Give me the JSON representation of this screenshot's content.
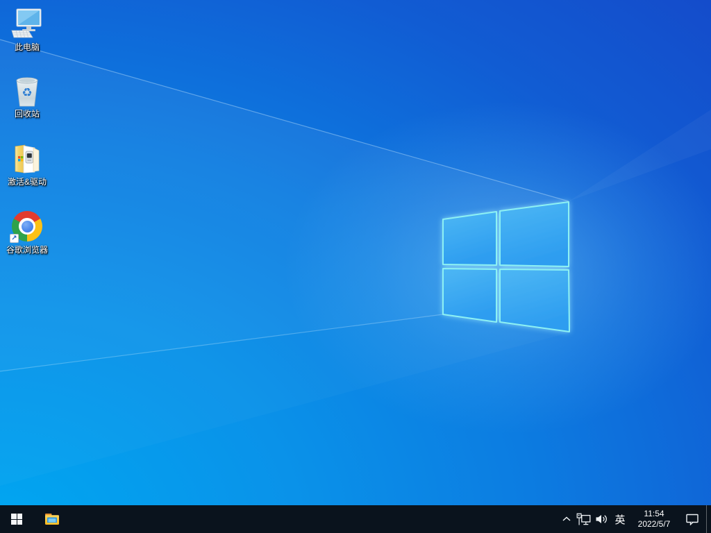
{
  "wallpaper": {
    "name": "windows-10-light-rays-default",
    "colors": {
      "base_bottom_left": "#00a7f1",
      "base_top_right": "#1547c8",
      "logo_pane_fill": "#38a9f1",
      "logo_pane_edge": "#8df1f3",
      "taskbar_background": "#0a131d"
    }
  },
  "desktop": {
    "icons": [
      {
        "id": "this-pc",
        "label": "此电脑"
      },
      {
        "id": "recycle-bin",
        "label": "回收站"
      },
      {
        "id": "activation-drivers",
        "label": "激活&驱动"
      },
      {
        "id": "google-chrome",
        "label": "谷歌浏览器"
      }
    ]
  },
  "taskbar": {
    "buttons": [
      {
        "id": "start",
        "icon": "windows-logo-icon"
      },
      {
        "id": "file-explorer",
        "icon": "folder-icon"
      }
    ],
    "tray": {
      "expand_icon": "chevron-up-icon",
      "network_icon": "ethernet-network-icon",
      "volume_icon": "speaker-volume-icon",
      "language_indicator": "英",
      "clock": {
        "time": "11:54",
        "date": "2022/5/7"
      },
      "action_center_icon": "notification-bubble-icon",
      "show_desktop": "show-desktop-strip"
    }
  }
}
